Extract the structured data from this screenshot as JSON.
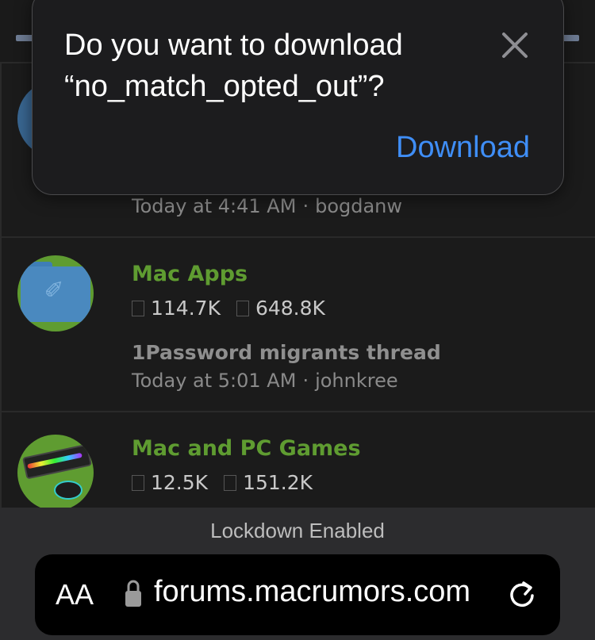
{
  "forum": {
    "rows": [
      {
        "latest_meta_time": "Today at 4:41 AM",
        "latest_meta_user": "bogdanw"
      },
      {
        "title": "Mac Apps",
        "threads": "114.7K",
        "messages": "648.8K",
        "latest_thread": "1Password migrants thread",
        "latest_meta_time": "Today at 5:01 AM",
        "latest_meta_user": "johnkree"
      },
      {
        "title": "Mac and PC Games",
        "threads": "12.5K",
        "messages": "151.2K"
      }
    ],
    "meta_separator": "·"
  },
  "dialog": {
    "title": "Do you want to download “no_match_opted_out”?",
    "download_label": "Download"
  },
  "lockdown": {
    "label": "Lockdown Enabled"
  },
  "urlbar": {
    "aa_label": "AA",
    "url": "forums.macrumors.com"
  },
  "colors": {
    "accent_blue": "#3f8ef7",
    "forum_green": "#5f9c31"
  }
}
